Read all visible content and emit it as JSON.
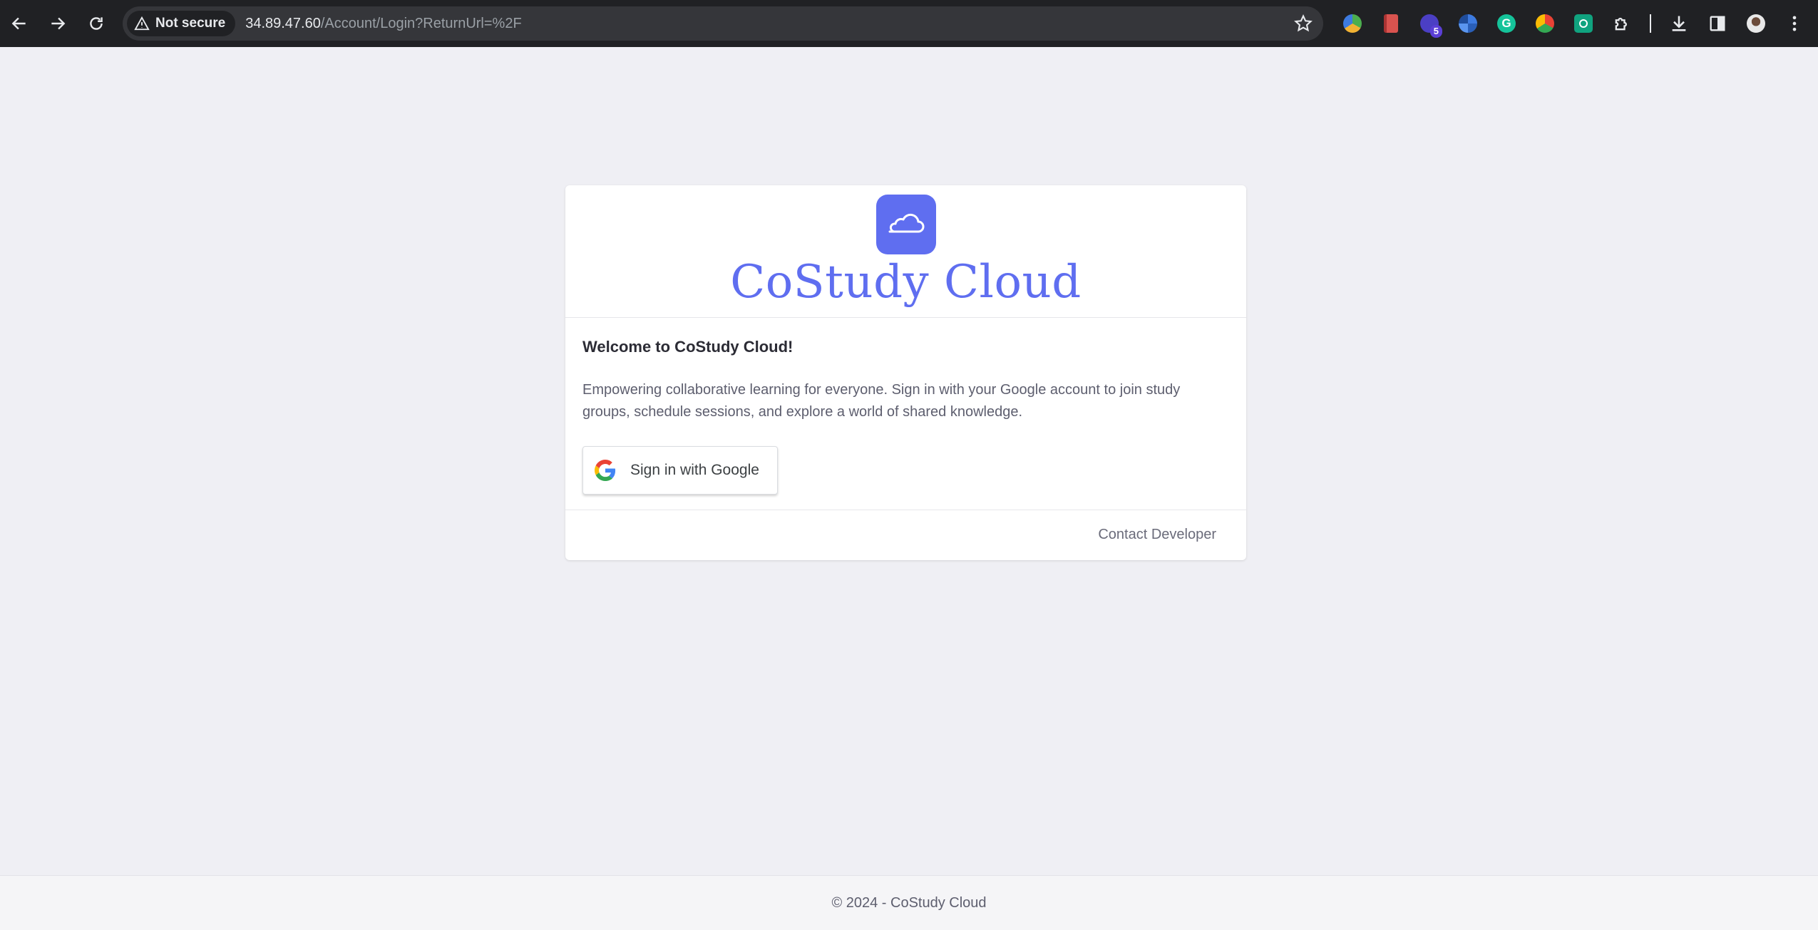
{
  "browser": {
    "security_label": "Not secure",
    "url_host": "34.89.47.60",
    "url_path": "/Account/Login?ReturnUrl=%2F",
    "extensions": [
      {
        "name": "colorful-circle-extension-icon",
        "color": "#4cae4f"
      },
      {
        "name": "red-book-extension-icon",
        "color": "#d9534f"
      },
      {
        "name": "purple-extension-icon",
        "color": "#4b3fc4",
        "badge": "5"
      },
      {
        "name": "blue-shutter-extension-icon",
        "color": "#3d7be0"
      },
      {
        "name": "grammarly-extension-icon",
        "color": "#15c39a"
      },
      {
        "name": "chrome-extension-icon",
        "color": "#e8a23a"
      },
      {
        "name": "chatgpt-extension-icon",
        "color": "#10a37f"
      }
    ]
  },
  "card": {
    "brand": "CoStudy Cloud",
    "welcome": "Welcome to CoStudy Cloud!",
    "description": "Empowering collaborative learning for everyone. Sign in with your Google account to join study groups, schedule sessions, and explore a world of shared knowledge.",
    "google_button": "Sign in with Google",
    "contact": "Contact Developer"
  },
  "footer": {
    "copyright": "© 2024 - CoStudy Cloud"
  },
  "colors": {
    "accent": "#5f6ef0",
    "background": "#efeff4"
  }
}
